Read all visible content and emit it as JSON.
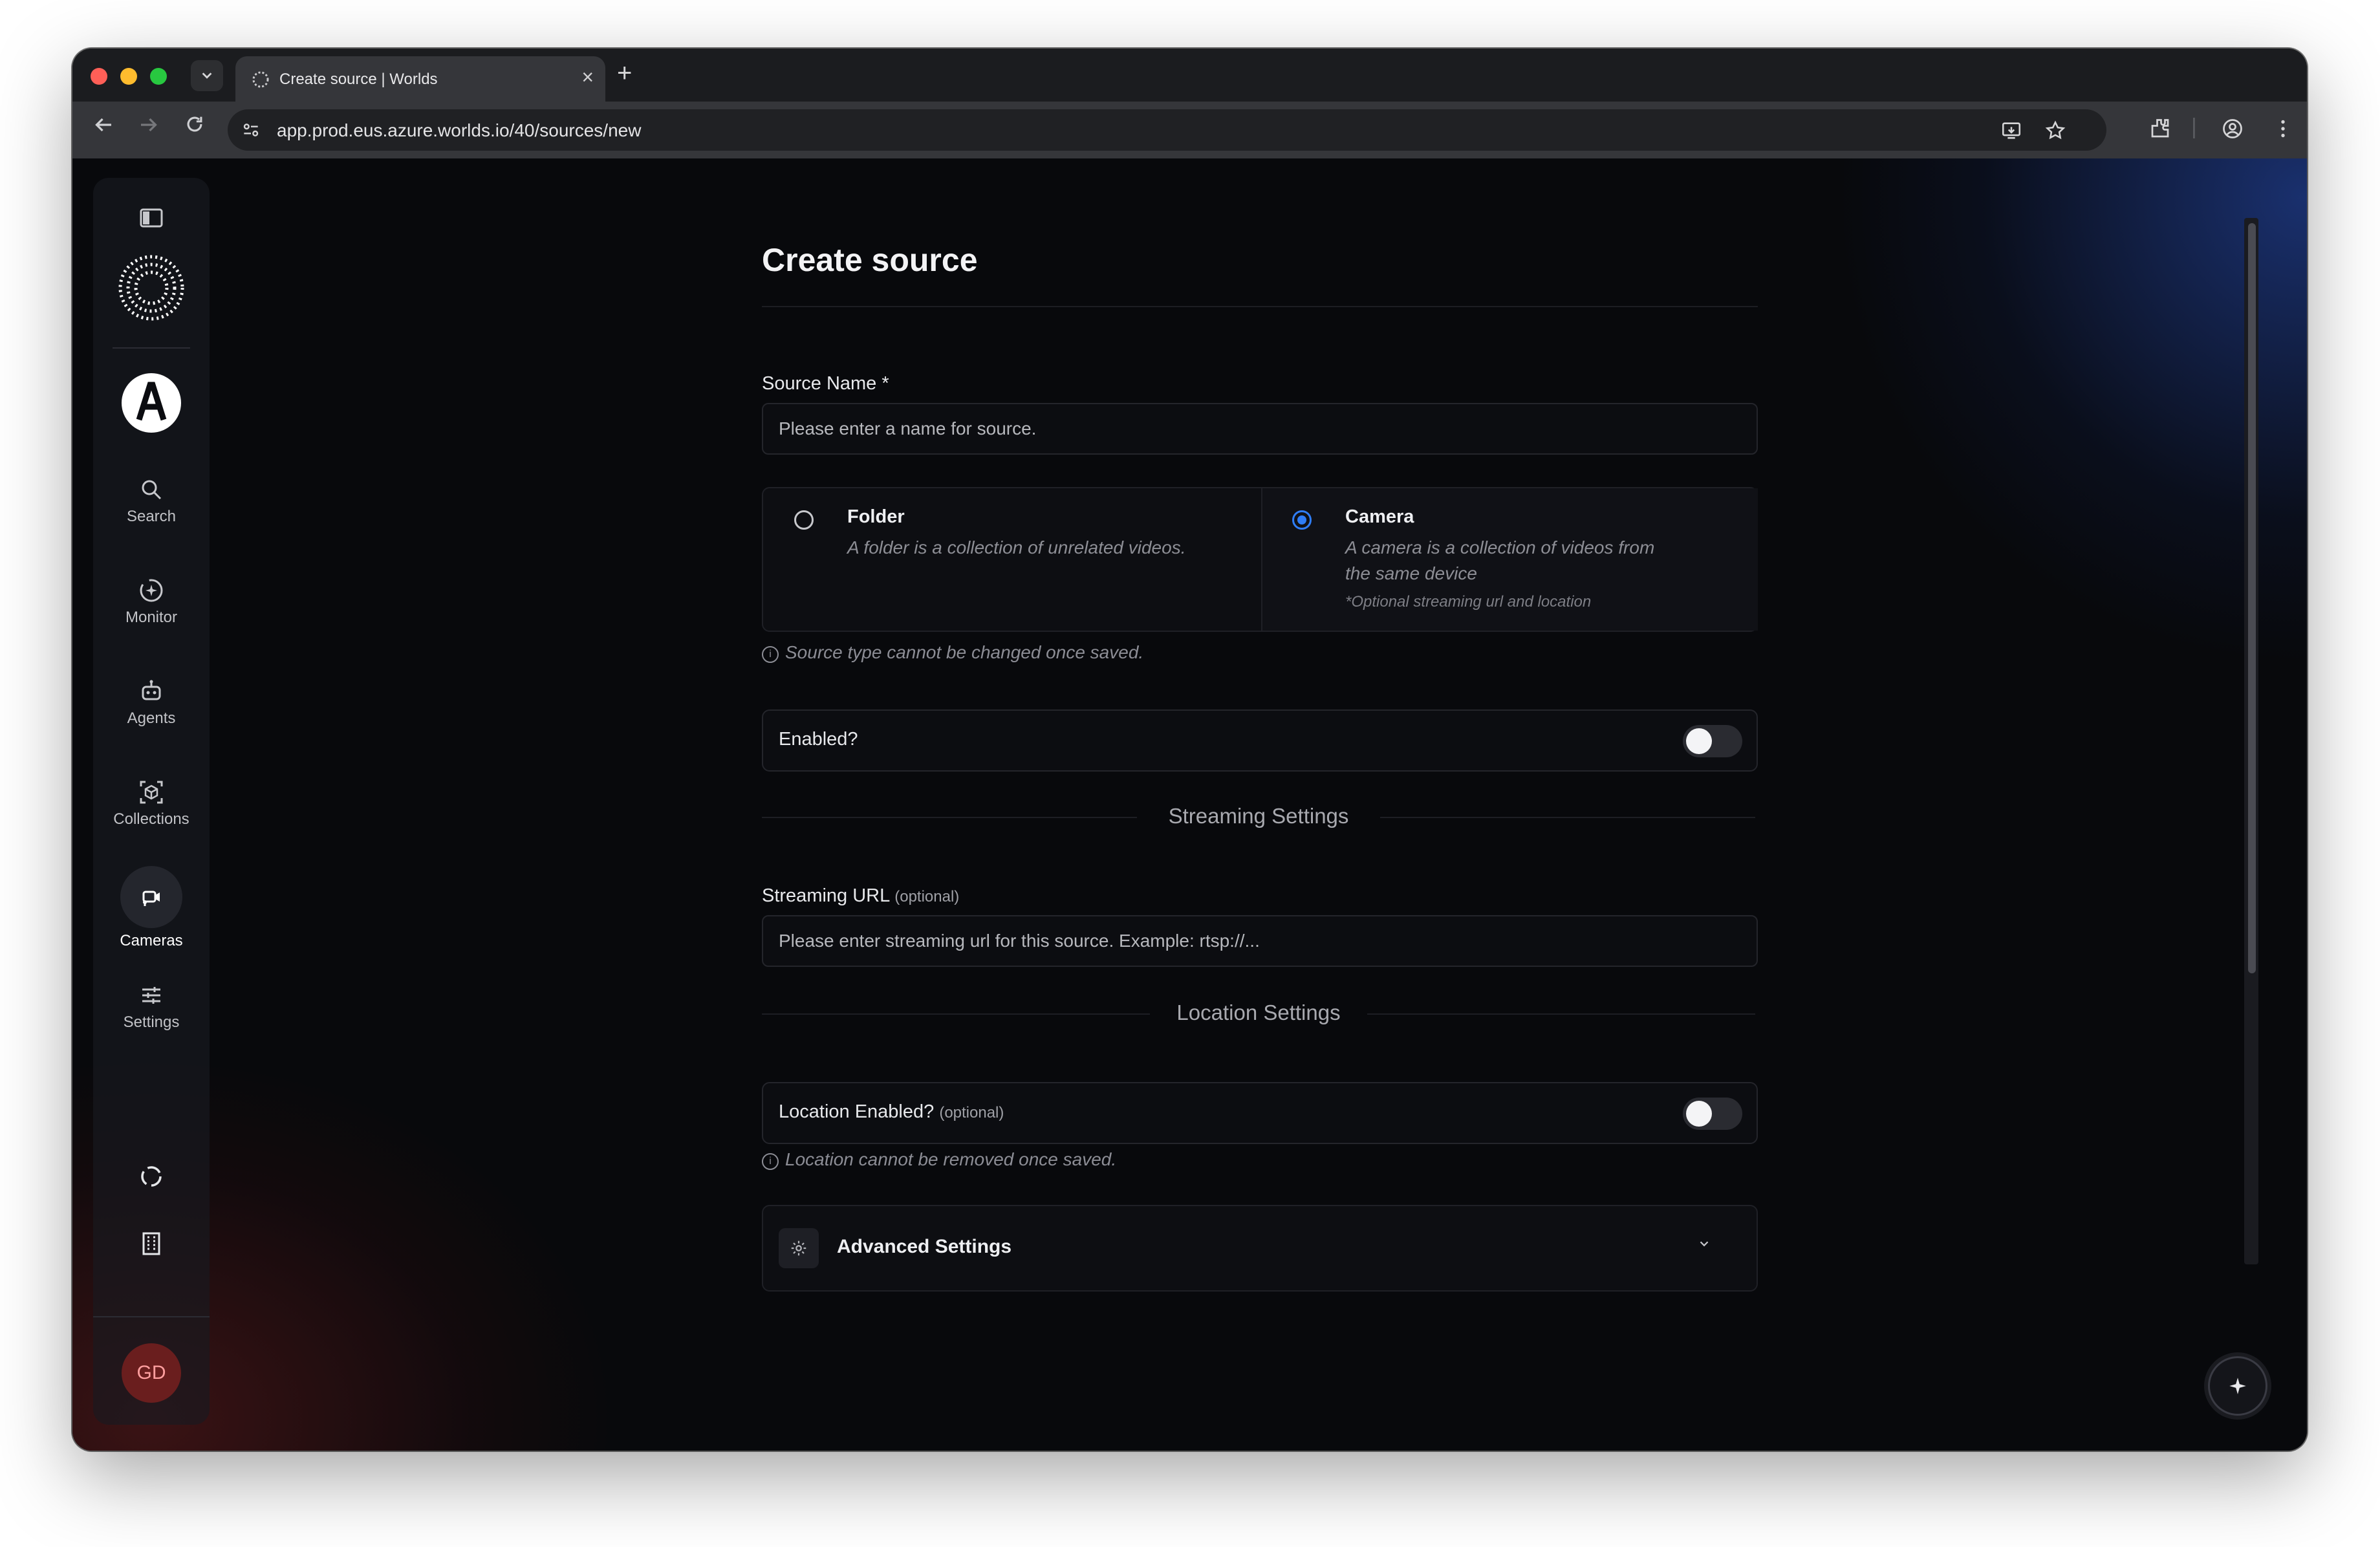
{
  "browser": {
    "tab_title": "Create source | Worlds",
    "url": "app.prod.eus.azure.worlds.io/40/sources/new",
    "new_tab": "+",
    "close_tab": "×",
    "dropdown": "⌄"
  },
  "sidebar": {
    "search": "Search",
    "monitor": "Monitor",
    "agents": "Agents",
    "collections": "Collections",
    "cameras": "Cameras",
    "settings": "Settings",
    "avatar_initials": "GD"
  },
  "form": {
    "title": "Create source",
    "source_name_label": "Source Name *",
    "source_name_placeholder": "Please enter a name for source.",
    "folder": {
      "title": "Folder",
      "description": "A folder is a collection of unrelated videos."
    },
    "camera": {
      "title": "Camera",
      "description_line1": "A camera is a collection of videos from",
      "description_line2": "the same device",
      "note": "*Optional streaming url and location",
      "selected": true
    },
    "source_type_hint": "Source type cannot be changed once saved.",
    "enabled_label": "Enabled?",
    "enabled_value": false,
    "streaming_section": "Streaming Settings",
    "streaming_url_label": "Streaming URL",
    "optional": "(optional)",
    "streaming_url_placeholder": "Please enter streaming url for this source. Example: rtsp://...",
    "location_section": "Location Settings",
    "location_enabled_label": "Location Enabled?",
    "location_enabled_value": false,
    "location_hint": "Location cannot be removed once saved.",
    "advanced_settings": "Advanced Settings"
  },
  "colors": {
    "accent": "#2f7df6",
    "background": "#08090c",
    "avatar": "#6a1e1e"
  }
}
